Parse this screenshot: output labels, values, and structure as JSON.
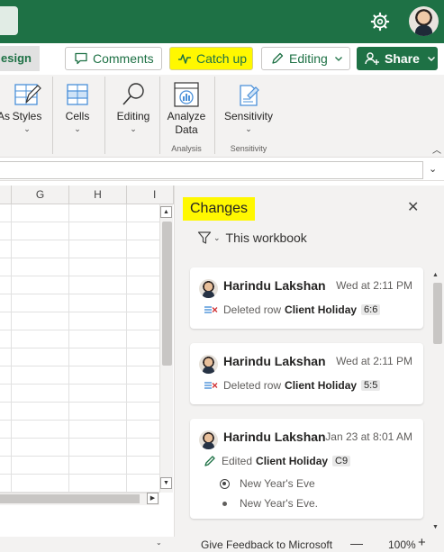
{
  "ribbon_tabs": {
    "design_tab_label": "esign"
  },
  "toolbar": {
    "comments_label": "Comments",
    "catchup_label": "Catch up",
    "editing_label": "Editing",
    "share_label": "Share"
  },
  "ribbon": {
    "styles_prefix": "As",
    "styles_label": "Styles",
    "cells_label": "Cells",
    "editing_label": "Editing",
    "analyze_label_1": "Analyze",
    "analyze_label_2": "Data",
    "analysis_group": "Analysis",
    "sensitivity_label": "Sensitivity",
    "sensitivity_group": "Sensitivity"
  },
  "grid": {
    "columns": [
      "G",
      "H",
      "I"
    ]
  },
  "changes_pane": {
    "title": "Changes",
    "filter_label": "This workbook",
    "cards": [
      {
        "user": "Harindu Lakshan",
        "time": "Wed at 2:11 PM",
        "action": "Deleted row",
        "sheet": "Client Holiday",
        "ref": "6:6"
      },
      {
        "user": "Harindu Lakshan",
        "time": "Wed at 2:11 PM",
        "action": "Deleted row",
        "sheet": "Client Holiday",
        "ref": "5:5"
      },
      {
        "user": "Harindu Lakshan",
        "time": "Jan 23 at 8:01 AM",
        "action": "Edited",
        "sheet": "Client Holiday",
        "ref": "C9",
        "new_value": "New Year's Eve",
        "old_value": "New Year's Eve."
      }
    ]
  },
  "statusbar": {
    "feedback": "Give Feedback to Microsoft",
    "zoom": "100%",
    "zoom_minus": "—",
    "zoom_plus": "+"
  },
  "colors": {
    "brand": "#1e7145",
    "highlight": "#fff800",
    "pane_bg": "#f3f2f1"
  },
  "icons": [
    "gear-icon",
    "avatar",
    "comment-icon",
    "activity-icon",
    "pencil-icon",
    "share-person-icon",
    "styles-icon",
    "cells-icon",
    "find-icon",
    "analyze-data-icon",
    "sensitivity-icon",
    "filter-icon",
    "close-icon",
    "delete-row-icon",
    "edit-pencil-icon"
  ]
}
